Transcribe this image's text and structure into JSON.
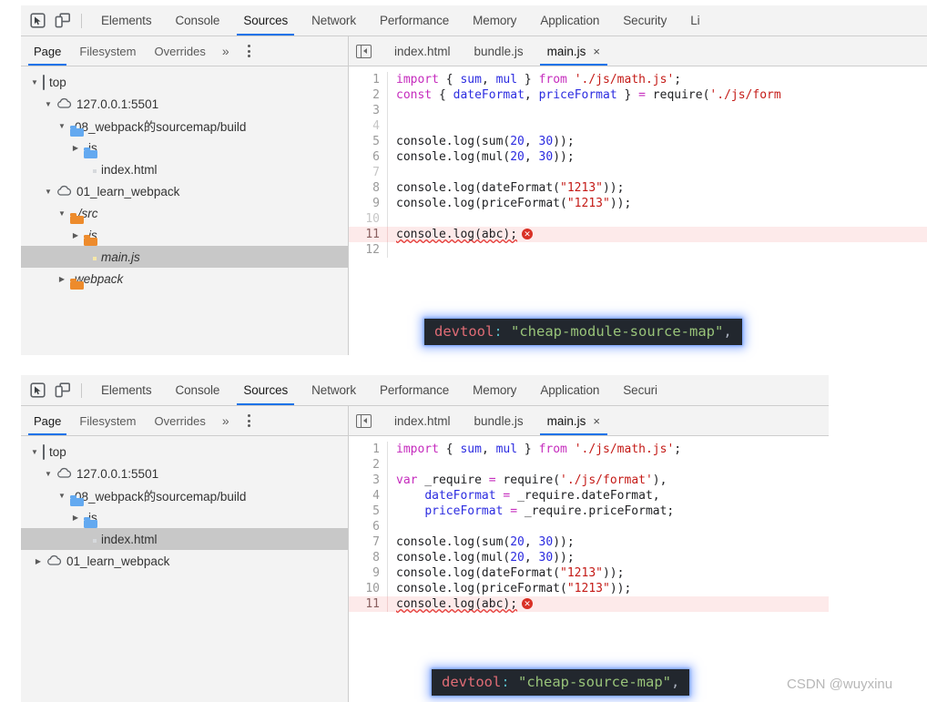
{
  "panels": [
    {
      "id": "panel-top",
      "toolbar": {
        "inspect_icon": "inspect-element-icon",
        "device_icon": "device-toolbar-icon",
        "tabs": [
          {
            "label": "Elements",
            "selected": false
          },
          {
            "label": "Console",
            "selected": false
          },
          {
            "label": "Sources",
            "selected": true
          },
          {
            "label": "Network",
            "selected": false
          },
          {
            "label": "Performance",
            "selected": false
          },
          {
            "label": "Memory",
            "selected": false
          },
          {
            "label": "Application",
            "selected": false
          },
          {
            "label": "Security",
            "selected": false
          },
          {
            "label": "Li",
            "selected": false
          }
        ]
      },
      "navigator": {
        "tabs": [
          {
            "label": "Page",
            "selected": true
          },
          {
            "label": "Filesystem",
            "selected": false
          },
          {
            "label": "Overrides",
            "selected": false
          }
        ],
        "more_label": "»",
        "menu_icon": "kebab-menu-icon",
        "tree": [
          {
            "label": "top",
            "depth": 0,
            "arrow": "down",
            "icon": "frame",
            "selected": false,
            "italic": false
          },
          {
            "label": "127.0.0.1:5501",
            "depth": 1,
            "arrow": "down",
            "icon": "cloud",
            "selected": false,
            "italic": false
          },
          {
            "label": "08_webpack的sourcemap/build",
            "depth": 2,
            "arrow": "down",
            "icon": "folder-blue",
            "selected": false,
            "italic": false
          },
          {
            "label": "js",
            "depth": 3,
            "arrow": "right",
            "icon": "folder-blue",
            "selected": false,
            "italic": false
          },
          {
            "label": "index.html",
            "depth": 3,
            "arrow": "none",
            "icon": "file-grey",
            "selected": false,
            "italic": false
          },
          {
            "label": "01_learn_webpack",
            "depth": 1,
            "arrow": "down",
            "icon": "cloud",
            "selected": false,
            "italic": false
          },
          {
            "label": "./src",
            "depth": 2,
            "arrow": "down",
            "icon": "folder-orange",
            "selected": false,
            "italic": true
          },
          {
            "label": "js",
            "depth": 3,
            "arrow": "right",
            "icon": "folder-orange",
            "selected": false,
            "italic": true
          },
          {
            "label": "main.js",
            "depth": 4,
            "arrow": "none",
            "icon": "file-yellow",
            "selected": true,
            "italic": true
          },
          {
            "label": "webpack",
            "depth": 2,
            "arrow": "right",
            "icon": "folder-orange",
            "selected": false,
            "italic": true
          }
        ]
      },
      "editor": {
        "collapse_icon": "collapse-navigator-icon",
        "file_tabs": [
          {
            "label": "index.html",
            "selected": false,
            "closable": false
          },
          {
            "label": "bundle.js",
            "selected": false,
            "closable": false
          },
          {
            "label": "main.js",
            "selected": true,
            "closable": true,
            "close_glyph": "×"
          }
        ],
        "lines": [
          {
            "n": "1",
            "tokens": [
              [
                "kw",
                "import"
              ],
              [
                "pl",
                " { "
              ],
              [
                "var",
                "sum"
              ],
              [
                "pl",
                ", "
              ],
              [
                "var",
                "mul"
              ],
              [
                "pl",
                " } "
              ],
              [
                "kw",
                "from"
              ],
              [
                "pl",
                " "
              ],
              [
                "str",
                "'./js/math.js'"
              ],
              [
                "pl",
                ";"
              ]
            ]
          },
          {
            "n": "2",
            "tokens": [
              [
                "kw",
                "const"
              ],
              [
                "pl",
                " { "
              ],
              [
                "var",
                "dateFormat"
              ],
              [
                "pl",
                ", "
              ],
              [
                "var",
                "priceFormat"
              ],
              [
                "pl",
                " } "
              ],
              [
                "kw2",
                "="
              ],
              [
                "pl",
                " require("
              ],
              [
                "str",
                "'./js/form"
              ]
            ]
          },
          {
            "n": "3",
            "tokens": []
          },
          {
            "n": "4",
            "tokens": [],
            "dim": true
          },
          {
            "n": "5",
            "tokens": [
              [
                "pl",
                "console.log(sum("
              ],
              [
                "num",
                "20"
              ],
              [
                "pl",
                ", "
              ],
              [
                "num",
                "30"
              ],
              [
                "pl",
                "));"
              ]
            ]
          },
          {
            "n": "6",
            "tokens": [
              [
                "pl",
                "console.log(mul("
              ],
              [
                "num",
                "20"
              ],
              [
                "pl",
                ", "
              ],
              [
                "num",
                "30"
              ],
              [
                "pl",
                "));"
              ]
            ]
          },
          {
            "n": "7",
            "tokens": [],
            "dim": true
          },
          {
            "n": "8",
            "tokens": [
              [
                "pl",
                "console.log(dateFormat("
              ],
              [
                "str",
                "\"1213\""
              ],
              [
                "pl",
                "));"
              ]
            ]
          },
          {
            "n": "9",
            "tokens": [
              [
                "pl",
                "console.log(priceFormat("
              ],
              [
                "str",
                "\"1213\""
              ],
              [
                "pl",
                "));"
              ]
            ]
          },
          {
            "n": "10",
            "tokens": [],
            "dim": true
          },
          {
            "n": "11",
            "tokens": [
              [
                "squig",
                "console.log(abc);"
              ]
            ],
            "error": true,
            "badge": "✕"
          },
          {
            "n": "12",
            "tokens": []
          }
        ]
      },
      "callout": {
        "key": "devtool:",
        "key_name": "devtool",
        "value": "\"cheap-module-source-map\"",
        "comma": ","
      }
    },
    {
      "id": "panel-bottom",
      "toolbar": {
        "inspect_icon": "inspect-element-icon",
        "device_icon": "device-toolbar-icon",
        "tabs": [
          {
            "label": "Elements",
            "selected": false
          },
          {
            "label": "Console",
            "selected": false
          },
          {
            "label": "Sources",
            "selected": true
          },
          {
            "label": "Network",
            "selected": false
          },
          {
            "label": "Performance",
            "selected": false
          },
          {
            "label": "Memory",
            "selected": false
          },
          {
            "label": "Application",
            "selected": false
          },
          {
            "label": "Securi",
            "selected": false
          }
        ]
      },
      "navigator": {
        "tabs": [
          {
            "label": "Page",
            "selected": true
          },
          {
            "label": "Filesystem",
            "selected": false
          },
          {
            "label": "Overrides",
            "selected": false
          }
        ],
        "more_label": "»",
        "menu_icon": "kebab-menu-icon",
        "tree": [
          {
            "label": "top",
            "depth": 0,
            "arrow": "down",
            "icon": "frame",
            "selected": false,
            "italic": false
          },
          {
            "label": "127.0.0.1:5501",
            "depth": 1,
            "arrow": "down",
            "icon": "cloud",
            "selected": false,
            "italic": false
          },
          {
            "label": "08_webpack的sourcemap/build",
            "depth": 2,
            "arrow": "down",
            "icon": "folder-blue",
            "selected": false,
            "italic": false
          },
          {
            "label": "js",
            "depth": 3,
            "arrow": "right",
            "icon": "folder-blue",
            "selected": false,
            "italic": false
          },
          {
            "label": "index.html",
            "depth": 3,
            "arrow": "none",
            "icon": "file-grey",
            "selected": true,
            "italic": false
          },
          {
            "label": "01_learn_webpack",
            "depth": 1,
            "arrow": "right",
            "icon": "cloud",
            "selected": false,
            "italic": false
          }
        ]
      },
      "editor": {
        "collapse_icon": "collapse-navigator-icon",
        "file_tabs": [
          {
            "label": "index.html",
            "selected": false,
            "closable": false
          },
          {
            "label": "bundle.js",
            "selected": false,
            "closable": false
          },
          {
            "label": "main.js",
            "selected": true,
            "closable": true,
            "close_glyph": "×"
          }
        ],
        "lines": [
          {
            "n": "1",
            "tokens": [
              [
                "kw",
                "import"
              ],
              [
                "pl",
                " { "
              ],
              [
                "var",
                "sum"
              ],
              [
                "pl",
                ", "
              ],
              [
                "var",
                "mul"
              ],
              [
                "pl",
                " } "
              ],
              [
                "kw",
                "from"
              ],
              [
                "pl",
                " "
              ],
              [
                "str",
                "'./js/math.js'"
              ],
              [
                "pl",
                ";"
              ]
            ]
          },
          {
            "n": "2",
            "tokens": []
          },
          {
            "n": "3",
            "tokens": [
              [
                "kw",
                "var"
              ],
              [
                "pl",
                " _require "
              ],
              [
                "kw2",
                "="
              ],
              [
                "pl",
                " require("
              ],
              [
                "str",
                "'./js/format'"
              ],
              [
                "pl",
                "),"
              ]
            ]
          },
          {
            "n": "4",
            "tokens": [
              [
                "pl",
                "    "
              ],
              [
                "var",
                "dateFormat"
              ],
              [
                "pl",
                " "
              ],
              [
                "kw2",
                "="
              ],
              [
                "pl",
                " _require.dateFormat,"
              ]
            ]
          },
          {
            "n": "5",
            "tokens": [
              [
                "pl",
                "    "
              ],
              [
                "var",
                "priceFormat"
              ],
              [
                "pl",
                " "
              ],
              [
                "kw2",
                "="
              ],
              [
                "pl",
                " _require.priceFormat;"
              ]
            ]
          },
          {
            "n": "6",
            "tokens": []
          },
          {
            "n": "7",
            "tokens": [
              [
                "pl",
                "console.log(sum("
              ],
              [
                "num",
                "20"
              ],
              [
                "pl",
                ", "
              ],
              [
                "num",
                "30"
              ],
              [
                "pl",
                "));"
              ]
            ]
          },
          {
            "n": "8",
            "tokens": [
              [
                "pl",
                "console.log(mul("
              ],
              [
                "num",
                "20"
              ],
              [
                "pl",
                ", "
              ],
              [
                "num",
                "30"
              ],
              [
                "pl",
                "));"
              ]
            ]
          },
          {
            "n": "9",
            "tokens": [
              [
                "pl",
                "console.log(dateFormat("
              ],
              [
                "str",
                "\"1213\""
              ],
              [
                "pl",
                "));"
              ]
            ]
          },
          {
            "n": "10",
            "tokens": [
              [
                "pl",
                "console.log(priceFormat("
              ],
              [
                "str",
                "\"1213\""
              ],
              [
                "pl",
                "));"
              ]
            ]
          },
          {
            "n": "11",
            "tokens": [
              [
                "squig",
                "console.log(abc);"
              ]
            ],
            "error": true,
            "badge": "✕"
          }
        ]
      },
      "callout": {
        "key": "devtool:",
        "key_name": "devtool",
        "value": "\"cheap-source-map\"",
        "comma": ","
      }
    }
  ],
  "watermark": "CSDN @wuyxinu",
  "colors": {
    "accent": "#1a73e8",
    "panel_bg": "#f3f3f3",
    "error_row": "#fdeaea",
    "string": "#c41a16",
    "keyword": "#c52bbd",
    "number": "#2c2ce0",
    "folder_blue": "#63a9f0",
    "folder_orange": "#ed8b2c",
    "file_yellow": "#e8c547",
    "callout_bg": "#22272e",
    "callout_key": "#e06c75",
    "callout_value": "#98c379"
  }
}
